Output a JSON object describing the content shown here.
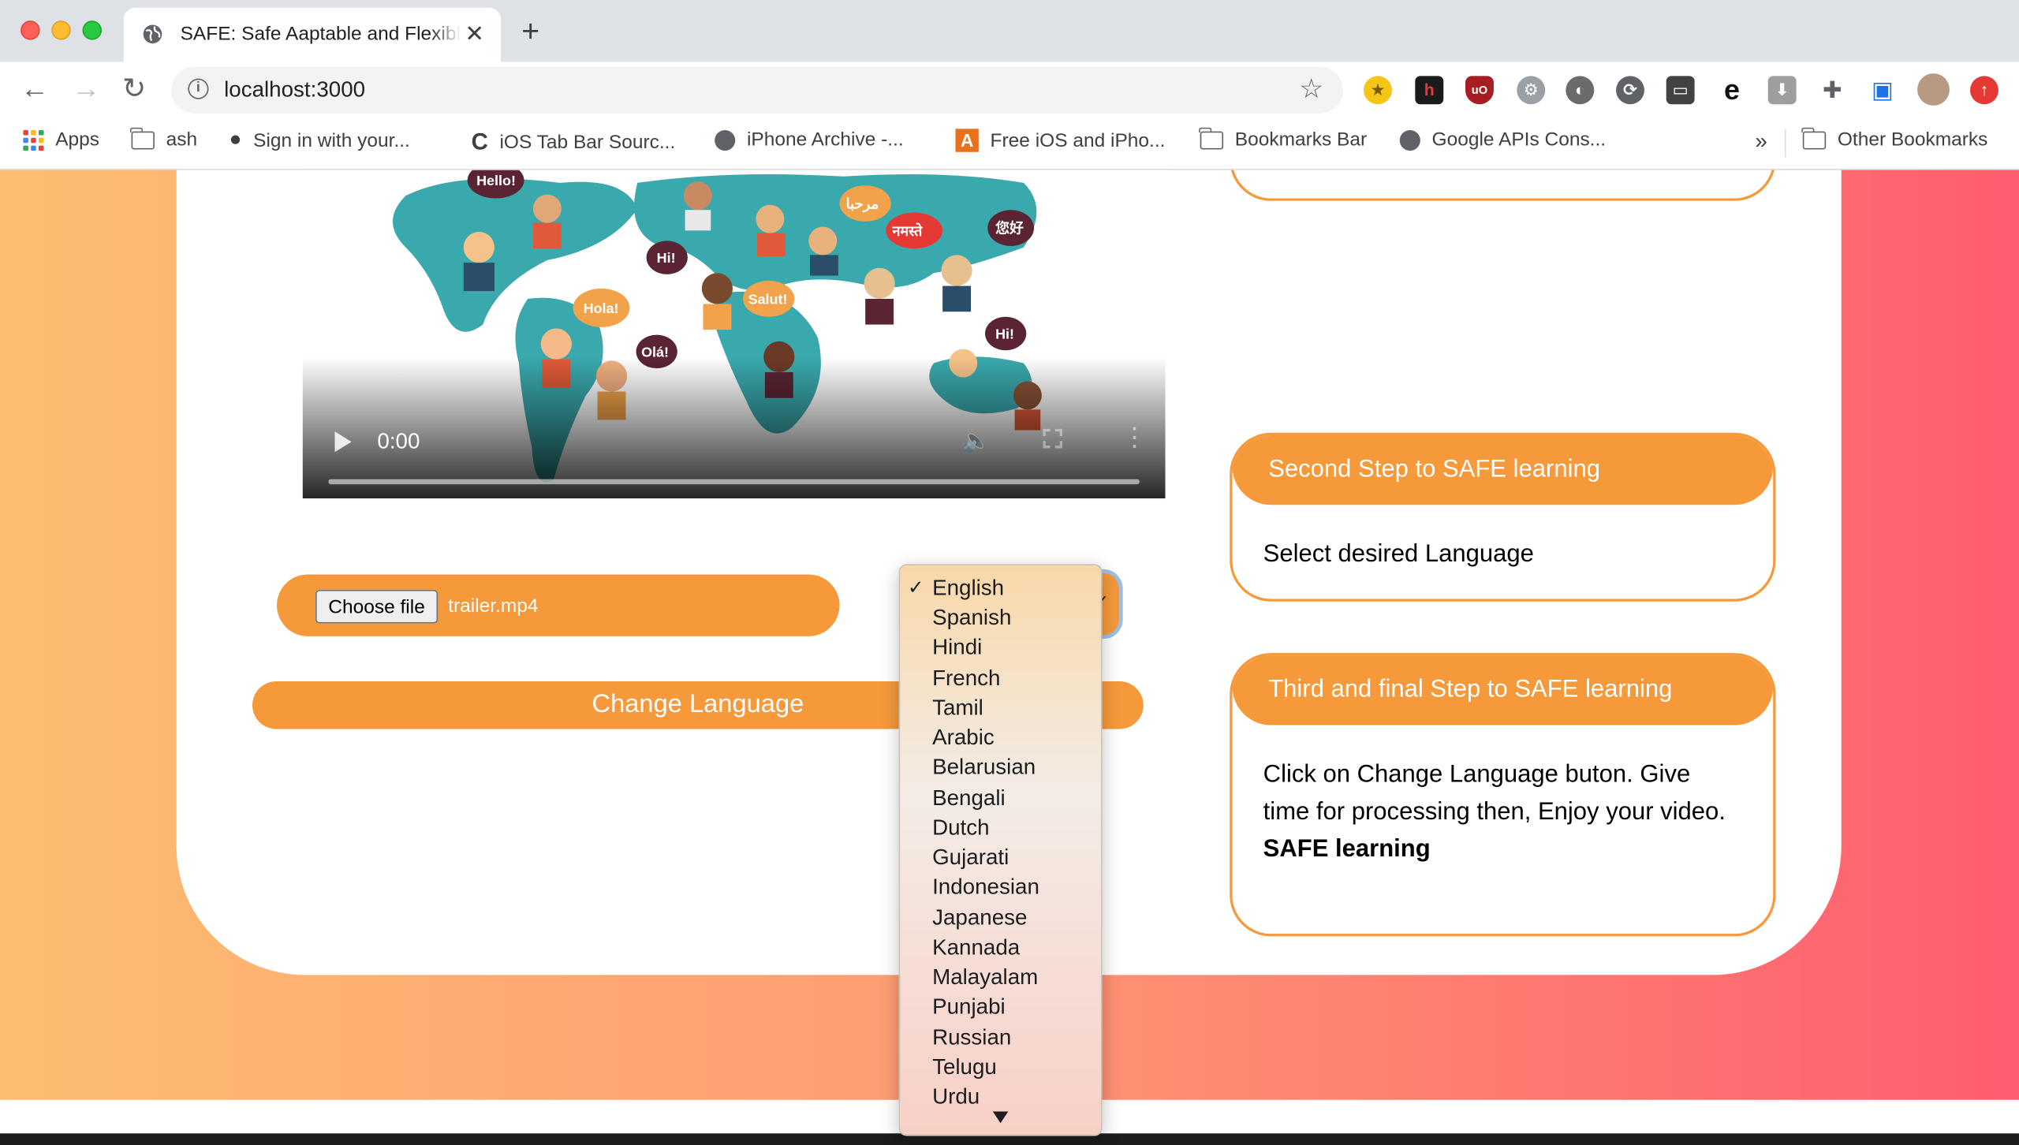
{
  "browser": {
    "tab_title": "SAFE: Safe Aaptable and Flexible",
    "url": "localhost:3000",
    "bookmarks": [
      {
        "label": "Apps",
        "icon": "apps-grid-icon"
      },
      {
        "label": "ash",
        "icon": "folder-icon"
      },
      {
        "label": "Sign in with your...",
        "icon": "apple-icon"
      },
      {
        "label": "iOS Tab Bar Sourc...",
        "icon": "c-logo-icon"
      },
      {
        "label": "iPhone Archive -...",
        "icon": "globe-icon"
      },
      {
        "label": "Free iOS and iPho...",
        "icon": "a-logo-icon"
      },
      {
        "label": "Bookmarks Bar",
        "icon": "folder-icon"
      },
      {
        "label": "Google APIs Cons...",
        "icon": "globe-icon"
      }
    ],
    "overflow_label": "»",
    "other_bookmarks": "Other Bookmarks"
  },
  "player": {
    "time": "0:00"
  },
  "upload": {
    "choose_label": "Choose file",
    "file_name": "trailer.mp4"
  },
  "actions": {
    "change_language": "Change Language"
  },
  "steps": [
    {
      "title": "Second Step to SAFE learning",
      "body": "Select desired Language"
    },
    {
      "title": "Third and final Step to SAFE learning",
      "body": "Click on Change Language buton. Give time for processing then, Enjoy your video.",
      "emphasis": "SAFE learning"
    }
  ],
  "language_dropdown": {
    "selected": "English",
    "options": [
      "English",
      "Spanish",
      "Hindi",
      "French",
      "Tamil",
      "Arabic",
      "Belarusian",
      "Bengali",
      "Dutch",
      "Gujarati",
      "Indonesian",
      "Japanese",
      "Kannada",
      "Malayalam",
      "Punjabi",
      "Russian",
      "Telugu",
      "Urdu"
    ]
  },
  "colors": {
    "accent": "#f5993b",
    "gradient_left": "#fdbd72",
    "gradient_right": "#fe5d6f"
  }
}
